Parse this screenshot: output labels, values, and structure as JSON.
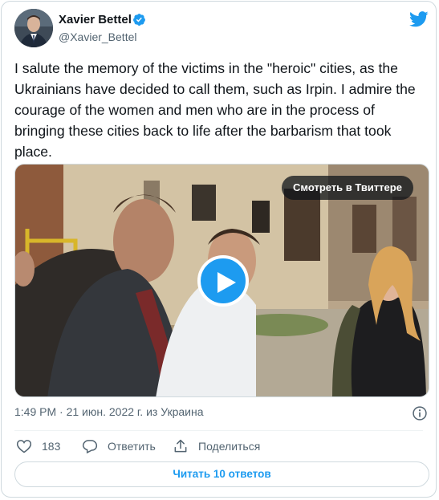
{
  "author": {
    "name": "Xavier Bettel",
    "handle": "@Xavier_Bettel",
    "verified": true
  },
  "tweet": {
    "text": "I salute the memory of the victims in the \"heroic\" cities, as the Ukrainians have decided to call them, such as Irpin. I admire the courage of the women and men who are in the process of bringing these cities back to life after the barbarism that took place."
  },
  "media": {
    "watch_label": "Смотреть в Твиттере"
  },
  "meta": {
    "timestamp": "1:49 PM · 21 июн. 2022 г. из Украина"
  },
  "actions": {
    "like_count": "183",
    "reply_label": "Ответить",
    "share_label": "Поделиться"
  },
  "footer": {
    "read_replies_label": "Читать 10 ответов"
  },
  "colors": {
    "accent": "#1d9bf0",
    "text": "#0f1419",
    "secondary": "#536471",
    "border": "#cfd9de"
  }
}
